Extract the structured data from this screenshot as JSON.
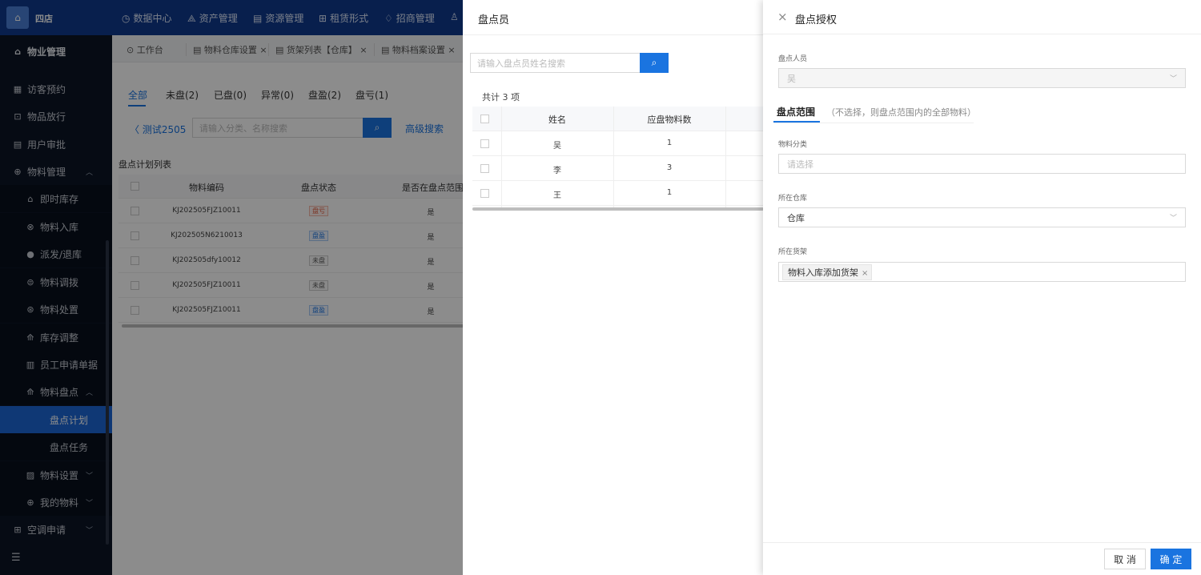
{
  "topbar": {
    "brand": "四店",
    "nav": [
      {
        "icon": "◷",
        "label": "数据中心"
      },
      {
        "icon": "⟁",
        "label": "资产管理"
      },
      {
        "icon": "▤",
        "label": "资源管理"
      },
      {
        "icon": "⊞",
        "label": "租赁形式"
      },
      {
        "icon": "♢",
        "label": "招商管理"
      },
      {
        "icon": "♙",
        "label": ""
      }
    ]
  },
  "sidebar": {
    "items": [
      {
        "icon": "⌂",
        "label": "物业管理"
      },
      {
        "icon": "▦",
        "label": "访客预约"
      },
      {
        "icon": "⊡",
        "label": "物品放行"
      },
      {
        "icon": "▤",
        "label": "用户审批"
      },
      {
        "icon": "⊕",
        "label": "物料管理"
      },
      {
        "icon": "⌂",
        "label": "即时库存"
      },
      {
        "icon": "⊗",
        "label": "物料入库"
      },
      {
        "icon": "●",
        "label": "派发/退库"
      },
      {
        "icon": "⊜",
        "label": "物料调拨"
      },
      {
        "icon": "⊛",
        "label": "物料处置"
      },
      {
        "icon": "⟰",
        "label": "库存调整"
      },
      {
        "icon": "▥",
        "label": "员工申请单据"
      },
      {
        "icon": "⟰",
        "label": "物料盘点"
      },
      {
        "icon": "",
        "label": "盘点计划"
      },
      {
        "icon": "",
        "label": "盘点任务"
      },
      {
        "icon": "▨",
        "label": "物料设置"
      },
      {
        "icon": "⊕",
        "label": "我的物料"
      },
      {
        "icon": "⊞",
        "label": "空调申请"
      }
    ],
    "collapse_icon": "☰"
  },
  "tabbar": {
    "tabs": [
      {
        "label": "⊙ 工作台"
      },
      {
        "label": "▤ 物料仓库设置 ×"
      },
      {
        "label": "▤ 货架列表【仓库】 ×"
      },
      {
        "label": "▤ 物料档案设置 ×"
      }
    ]
  },
  "main": {
    "status_tabs": [
      "全部",
      "未盘(2)",
      "已盘(0)",
      "异常(0)",
      "盘盈(2)",
      "盘亏(1)"
    ],
    "plan_name": "测试2505",
    "search_placeholder": "请输入分类、名称搜索",
    "advanced_search": "高级搜索",
    "list_title": "盘点计划列表",
    "columns": [
      "物料编码",
      "盘点状态",
      "是否在盘点范围"
    ],
    "rows": [
      {
        "code": "KJ202505FJZ10011",
        "status": "盘亏",
        "inrange": "是"
      },
      {
        "code": "KJ202505N6210013",
        "status": "盘盈",
        "inrange": "是"
      },
      {
        "code": "KJ202505dfy10012",
        "status": "未盘",
        "inrange": "是"
      },
      {
        "code": "KJ202505FJZ10011",
        "status": "未盘",
        "inrange": "是"
      },
      {
        "code": "KJ202505FJZ10011",
        "status": "盘盈",
        "inrange": "是"
      }
    ]
  },
  "drawer1": {
    "title": "盘点员",
    "search_placeholder": "请输入盘点员姓名搜索",
    "total": "共计 3 项",
    "columns": [
      "姓名",
      "应盘物料数"
    ],
    "rows": [
      {
        "name": "吴",
        "count": "1"
      },
      {
        "name": "李",
        "count": "3"
      },
      {
        "name": "王",
        "count": "1"
      }
    ]
  },
  "drawer2": {
    "title": "盘点授权",
    "person_label": "盘点人员",
    "person_value": "吴",
    "scope_tab": "盘点范围",
    "scope_hint": "（不选择，则盘点范围内的全部物料）",
    "category_label": "物料分类",
    "category_placeholder": "请选择",
    "warehouse_label": "所在仓库",
    "warehouse_value": "仓库",
    "shelf_label": "所在货架",
    "shelf_tag": "物料入库添加货架",
    "cancel": "取 消",
    "confirm": "确 定"
  },
  "colors": {
    "accent": "#1a74e0",
    "topbar": "#0f3a8c",
    "sidebar": "#0b1526",
    "loss": "#e05a3a"
  }
}
